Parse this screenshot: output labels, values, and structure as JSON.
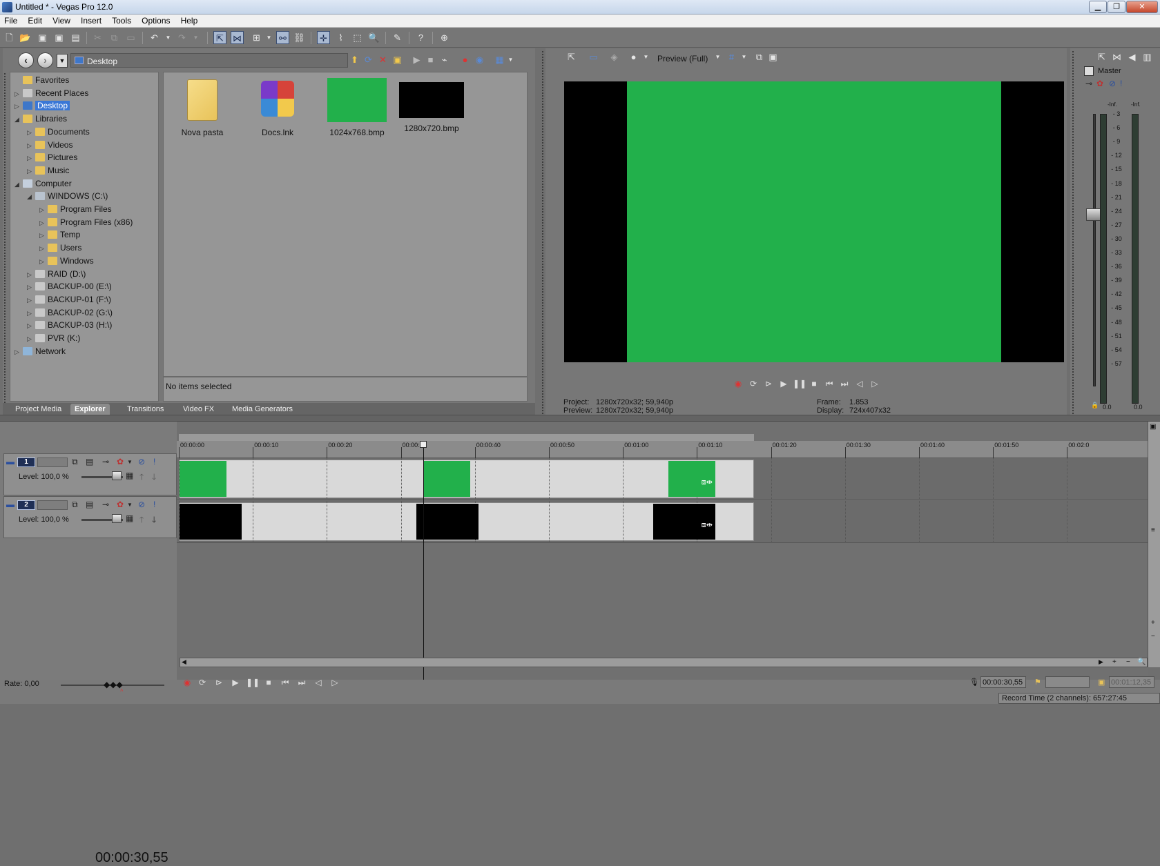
{
  "window": {
    "title": "Untitled * - Vegas Pro 12.0",
    "min": "▁",
    "restore": "❐",
    "close": "✕"
  },
  "menu": [
    "File",
    "Edit",
    "View",
    "Insert",
    "Tools",
    "Options",
    "Help"
  ],
  "explorer": {
    "path": "Desktop",
    "tree": [
      {
        "label": "Favorites",
        "indent": 0,
        "icon": "star-folder-icon",
        "color": "#e8c35a"
      },
      {
        "label": "Recent Places",
        "indent": 0,
        "icon": "recent-icon",
        "color": "#c8c8c8",
        "arrow": "▷"
      },
      {
        "label": "Desktop",
        "indent": 0,
        "icon": "desktop-icon",
        "color": "#3e77c9",
        "arrow": "▷",
        "selected": true
      },
      {
        "label": "Libraries",
        "indent": 0,
        "icon": "library-icon",
        "color": "#e8c35a",
        "arrow": "◢"
      },
      {
        "label": "Documents",
        "indent": 1,
        "icon": "documents-icon",
        "color": "#e8c35a",
        "arrow": "▷"
      },
      {
        "label": "Videos",
        "indent": 1,
        "icon": "videos-icon",
        "color": "#e8c35a",
        "arrow": "▷"
      },
      {
        "label": "Pictures",
        "indent": 1,
        "icon": "pictures-icon",
        "color": "#e8c35a",
        "arrow": "▷"
      },
      {
        "label": "Music",
        "indent": 1,
        "icon": "music-icon",
        "color": "#e8c35a",
        "arrow": "▷"
      },
      {
        "label": "Computer",
        "indent": 0,
        "icon": "computer-icon",
        "color": "#c4cfdd",
        "arrow": "◢"
      },
      {
        "label": "WINDOWS (C:\\)",
        "indent": 1,
        "icon": "drive-icon",
        "color": "#b9c3cf",
        "arrow": "◢"
      },
      {
        "label": "Program Files",
        "indent": 2,
        "icon": "folder-icon",
        "color": "#e8c35a",
        "arrow": "▷"
      },
      {
        "label": "Program Files (x86)",
        "indent": 2,
        "icon": "folder-icon",
        "color": "#e8c35a",
        "arrow": "▷"
      },
      {
        "label": "Temp",
        "indent": 2,
        "icon": "folder-icon",
        "color": "#e8c35a",
        "arrow": "▷"
      },
      {
        "label": "Users",
        "indent": 2,
        "icon": "folder-icon",
        "color": "#e8c35a",
        "arrow": "▷"
      },
      {
        "label": "Windows",
        "indent": 2,
        "icon": "folder-icon",
        "color": "#e8c35a",
        "arrow": "▷"
      },
      {
        "label": "RAID (D:\\)",
        "indent": 1,
        "icon": "drive-icon",
        "color": "#c9c9c9",
        "arrow": "▷"
      },
      {
        "label": "BACKUP-00 (E:\\)",
        "indent": 1,
        "icon": "drive-icon",
        "color": "#c9c9c9",
        "arrow": "▷"
      },
      {
        "label": "BACKUP-01 (F:\\)",
        "indent": 1,
        "icon": "drive-icon",
        "color": "#c9c9c9",
        "arrow": "▷"
      },
      {
        "label": "BACKUP-02 (G:\\)",
        "indent": 1,
        "icon": "drive-icon",
        "color": "#c9c9c9",
        "arrow": "▷"
      },
      {
        "label": "BACKUP-03 (H:\\)",
        "indent": 1,
        "icon": "drive-icon",
        "color": "#c9c9c9",
        "arrow": "▷"
      },
      {
        "label": "PVR (K:)",
        "indent": 1,
        "icon": "drive-icon",
        "color": "#c9c9c9",
        "arrow": "▷"
      },
      {
        "label": "Network",
        "indent": 0,
        "icon": "network-icon",
        "color": "#8fb5d9",
        "arrow": "▷"
      }
    ],
    "files": [
      {
        "name": "Nova pasta",
        "icon": "folder-icon",
        "color": "#e8c35a"
      },
      {
        "name": "Docs.lnk",
        "icon": "shortcut-icon",
        "color": "#d6433a"
      },
      {
        "name": "1024x768.bmp",
        "icon": "bitmap-thumb",
        "color": "#22b04b"
      },
      {
        "name": "1280x720.bmp",
        "icon": "bitmap-thumb",
        "color": "#000000"
      }
    ],
    "status": "No items selected",
    "tabs": [
      "Project Media",
      "Explorer",
      "Transitions",
      "Video FX",
      "Media Generators"
    ],
    "active_tab": "Explorer"
  },
  "preview": {
    "quality": "Preview (Full)",
    "project_label": "Project:",
    "project_value": "1280x720x32; 59,940p",
    "preview_label": "Preview:",
    "preview_value": "1280x720x32; 59,940p",
    "frame_label": "Frame:",
    "frame_value": "1.853",
    "display_label": "Display:",
    "display_value": "724x407x32",
    "green": "#22b04b"
  },
  "mixer": {
    "label": "Master",
    "inf_left": "-Inf.",
    "inf_right": "-Inf.",
    "scale": [
      "3",
      "6",
      "9",
      "12",
      "15",
      "18",
      "21",
      "24",
      "27",
      "30",
      "33",
      "36",
      "39",
      "42",
      "45",
      "48",
      "51",
      "54",
      "57"
    ],
    "foot_left": "0.0",
    "foot_right": "0.0"
  },
  "timeline": {
    "timecode": "00:00:30,55",
    "ruler": [
      "00:00:00",
      "00:00:10",
      "00:00:20",
      "00:00:30",
      "00:00:40",
      "00:00:50",
      "00:01:00",
      "00:01:10",
      "00:01:20",
      "00:01:30",
      "00:01:40",
      "00:01:50",
      "00:02:0"
    ],
    "tracks": [
      {
        "num": "1",
        "level": "Level: 100,0 %",
        "clip_color": "#22b04b"
      },
      {
        "num": "2",
        "level": "Level: 100,0 %",
        "clip_color": "#000000"
      }
    ],
    "rate": "Rate: 0,00",
    "cursor_time": "00:00:30,55",
    "end_time": "00:01:12,35",
    "record_time": "Record Time (2 channels): 657:27:45"
  }
}
